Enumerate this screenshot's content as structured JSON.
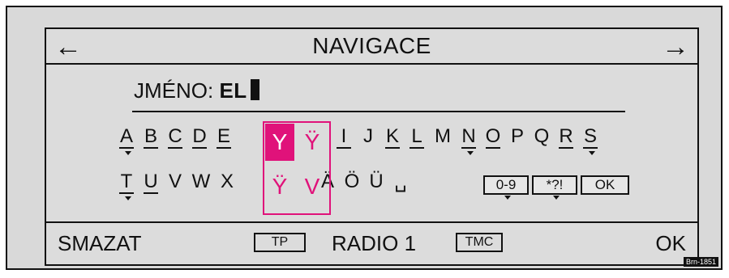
{
  "header": {
    "title": "NAVIGACE",
    "left_arrow": "←",
    "right_arrow": "→"
  },
  "name": {
    "label": "JMÉNO:",
    "value": "EL"
  },
  "keyboard": {
    "row1_a": [
      "A",
      "B",
      "C",
      "D",
      "E"
    ],
    "row1_b": [
      "I",
      "J",
      "K",
      "L",
      "M",
      "N",
      "O",
      "P",
      "Q",
      "R",
      "S"
    ],
    "row2_a": [
      "T",
      "U",
      "V",
      "W",
      "X"
    ],
    "row2_b": [
      "Ä",
      "Ö",
      "Ü",
      "␣"
    ],
    "highlight": {
      "selected": "Y",
      "options": [
        "Ÿ",
        "Ÿ",
        "V"
      ]
    },
    "modes": [
      "0-9",
      "*?!",
      "OK"
    ]
  },
  "footer": {
    "delete": "SMAZAT",
    "tp": "TP",
    "station": "RADIO 1",
    "tmc": "TMC",
    "ok": "OK"
  },
  "figure_code": "Brn-1851",
  "colors": {
    "highlight": "#e0127a",
    "screen_bg": "#dcdcdc"
  }
}
